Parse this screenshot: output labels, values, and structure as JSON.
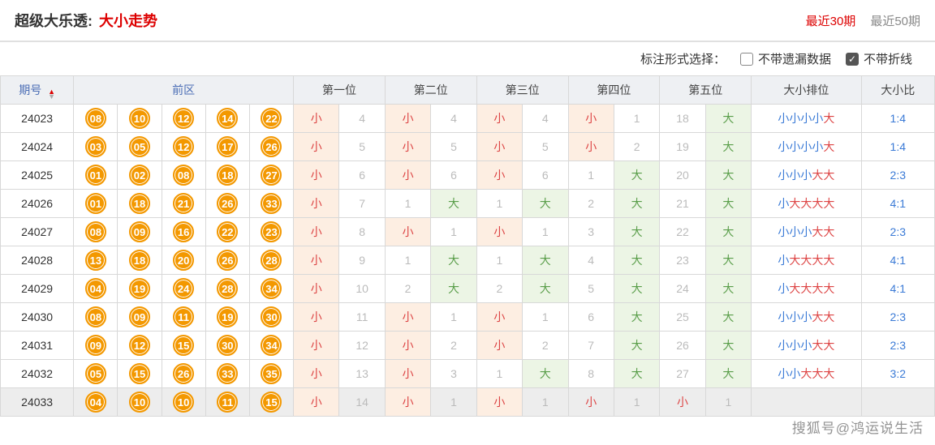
{
  "header": {
    "lottery_name": "超级大乐透:",
    "trend_name": "大小走势",
    "period_30": "最近30期",
    "period_50": "最近50期"
  },
  "options": {
    "label": "标注形式选择：",
    "opt1": "不带遗漏数据",
    "opt2": "不带折线"
  },
  "columns": {
    "qihao": "期号",
    "qianqu": "前区",
    "pos1": "第一位",
    "pos2": "第二位",
    "pos3": "第三位",
    "pos4": "第四位",
    "pos5": "第五位",
    "paiwei": "大小排位",
    "bi": "大小比"
  },
  "rows": [
    {
      "id": "24023",
      "balls": [
        "08",
        "10",
        "12",
        "14",
        "22"
      ],
      "c": [
        [
          "小",
          "h"
        ],
        [
          "4",
          "m"
        ],
        [
          "小",
          "h"
        ],
        [
          "4",
          "m"
        ],
        [
          "小",
          "h"
        ],
        [
          "4",
          "m"
        ],
        [
          "小",
          "h"
        ],
        [
          "1",
          "m"
        ],
        [
          "18",
          "m"
        ],
        [
          "大",
          "d"
        ]
      ],
      "pattern": [
        "x",
        "x",
        "x",
        "x",
        "d"
      ],
      "ratio": "1:4"
    },
    {
      "id": "24024",
      "balls": [
        "03",
        "05",
        "12",
        "17",
        "26"
      ],
      "c": [
        [
          "小",
          "h"
        ],
        [
          "5",
          "m"
        ],
        [
          "小",
          "h"
        ],
        [
          "5",
          "m"
        ],
        [
          "小",
          "h"
        ],
        [
          "5",
          "m"
        ],
        [
          "小",
          "h"
        ],
        [
          "2",
          "m"
        ],
        [
          "19",
          "m"
        ],
        [
          "大",
          "d"
        ]
      ],
      "pattern": [
        "x",
        "x",
        "x",
        "x",
        "d"
      ],
      "ratio": "1:4"
    },
    {
      "id": "24025",
      "balls": [
        "01",
        "02",
        "08",
        "18",
        "27"
      ],
      "c": [
        [
          "小",
          "h"
        ],
        [
          "6",
          "m"
        ],
        [
          "小",
          "h"
        ],
        [
          "6",
          "m"
        ],
        [
          "小",
          "h"
        ],
        [
          "6",
          "m"
        ],
        [
          "1",
          "m"
        ],
        [
          "大",
          "d"
        ],
        [
          "20",
          "m"
        ],
        [
          "大",
          "d"
        ]
      ],
      "pattern": [
        "x",
        "x",
        "x",
        "d",
        "d"
      ],
      "ratio": "2:3"
    },
    {
      "id": "24026",
      "balls": [
        "01",
        "18",
        "21",
        "26",
        "33"
      ],
      "c": [
        [
          "小",
          "h"
        ],
        [
          "7",
          "m"
        ],
        [
          "1",
          "m"
        ],
        [
          "大",
          "d"
        ],
        [
          "1",
          "m"
        ],
        [
          "大",
          "d"
        ],
        [
          "2",
          "m"
        ],
        [
          "大",
          "d"
        ],
        [
          "21",
          "m"
        ],
        [
          "大",
          "d"
        ]
      ],
      "pattern": [
        "x",
        "d",
        "d",
        "d",
        "d"
      ],
      "ratio": "4:1"
    },
    {
      "id": "24027",
      "balls": [
        "08",
        "09",
        "16",
        "22",
        "23"
      ],
      "c": [
        [
          "小",
          "h"
        ],
        [
          "8",
          "m"
        ],
        [
          "小",
          "h"
        ],
        [
          "1",
          "m"
        ],
        [
          "小",
          "h"
        ],
        [
          "1",
          "m"
        ],
        [
          "3",
          "m"
        ],
        [
          "大",
          "d"
        ],
        [
          "22",
          "m"
        ],
        [
          "大",
          "d"
        ]
      ],
      "pattern": [
        "x",
        "x",
        "x",
        "d",
        "d"
      ],
      "ratio": "2:3"
    },
    {
      "id": "24028",
      "balls": [
        "13",
        "18",
        "20",
        "26",
        "28"
      ],
      "c": [
        [
          "小",
          "h"
        ],
        [
          "9",
          "m"
        ],
        [
          "1",
          "m"
        ],
        [
          "大",
          "d"
        ],
        [
          "1",
          "m"
        ],
        [
          "大",
          "d"
        ],
        [
          "4",
          "m"
        ],
        [
          "大",
          "d"
        ],
        [
          "23",
          "m"
        ],
        [
          "大",
          "d"
        ]
      ],
      "pattern": [
        "x",
        "d",
        "d",
        "d",
        "d"
      ],
      "ratio": "4:1"
    },
    {
      "id": "24029",
      "balls": [
        "04",
        "19",
        "24",
        "28",
        "34"
      ],
      "c": [
        [
          "小",
          "h"
        ],
        [
          "10",
          "m"
        ],
        [
          "2",
          "m"
        ],
        [
          "大",
          "d"
        ],
        [
          "2",
          "m"
        ],
        [
          "大",
          "d"
        ],
        [
          "5",
          "m"
        ],
        [
          "大",
          "d"
        ],
        [
          "24",
          "m"
        ],
        [
          "大",
          "d"
        ]
      ],
      "pattern": [
        "x",
        "d",
        "d",
        "d",
        "d"
      ],
      "ratio": "4:1"
    },
    {
      "id": "24030",
      "balls": [
        "08",
        "09",
        "11",
        "19",
        "30"
      ],
      "c": [
        [
          "小",
          "h"
        ],
        [
          "11",
          "m"
        ],
        [
          "小",
          "h"
        ],
        [
          "1",
          "m"
        ],
        [
          "小",
          "h"
        ],
        [
          "1",
          "m"
        ],
        [
          "6",
          "m"
        ],
        [
          "大",
          "d"
        ],
        [
          "25",
          "m"
        ],
        [
          "大",
          "d"
        ]
      ],
      "pattern": [
        "x",
        "x",
        "x",
        "d",
        "d"
      ],
      "ratio": "2:3"
    },
    {
      "id": "24031",
      "balls": [
        "09",
        "12",
        "15",
        "30",
        "34"
      ],
      "c": [
        [
          "小",
          "h"
        ],
        [
          "12",
          "m"
        ],
        [
          "小",
          "h"
        ],
        [
          "2",
          "m"
        ],
        [
          "小",
          "h"
        ],
        [
          "2",
          "m"
        ],
        [
          "7",
          "m"
        ],
        [
          "大",
          "d"
        ],
        [
          "26",
          "m"
        ],
        [
          "大",
          "d"
        ]
      ],
      "pattern": [
        "x",
        "x",
        "x",
        "d",
        "d"
      ],
      "ratio": "2:3"
    },
    {
      "id": "24032",
      "balls": [
        "05",
        "15",
        "26",
        "33",
        "35"
      ],
      "c": [
        [
          "小",
          "h"
        ],
        [
          "13",
          "m"
        ],
        [
          "小",
          "h"
        ],
        [
          "3",
          "m"
        ],
        [
          "1",
          "m"
        ],
        [
          "大",
          "d"
        ],
        [
          "8",
          "m"
        ],
        [
          "大",
          "d"
        ],
        [
          "27",
          "m"
        ],
        [
          "大",
          "d"
        ]
      ],
      "pattern": [
        "x",
        "x",
        "d",
        "d",
        "d"
      ],
      "ratio": "3:2"
    },
    {
      "id": "24033",
      "balls": [
        "04",
        "10",
        "10",
        "11",
        "15"
      ],
      "c": [
        [
          "小",
          "h"
        ],
        [
          "14",
          "m"
        ],
        [
          "小",
          "h"
        ],
        [
          "1",
          "m"
        ],
        [
          "小",
          "h"
        ],
        [
          "1",
          "m"
        ],
        [
          "小",
          "r"
        ],
        [
          "1",
          "m"
        ],
        [
          "小",
          "r"
        ],
        [
          "1",
          "m"
        ]
      ],
      "pattern": [],
      "ratio": ""
    }
  ],
  "chart_data": {
    "type": "table",
    "title": "超级大乐透 大小走势",
    "columns": [
      "期号",
      "前区1",
      "前区2",
      "前区3",
      "前区4",
      "前区5",
      "第一位-小",
      "第一位-遗漏",
      "第二位-小",
      "第二位-遗漏",
      "第三位-小",
      "第三位-遗漏",
      "第四位-小/大",
      "第四位-遗漏",
      "第五位-小/大",
      "第五位-遗漏",
      "大小排位",
      "大小比"
    ],
    "data": [
      [
        "24023",
        8,
        10,
        12,
        14,
        22,
        "小",
        4,
        "小",
        4,
        "小",
        4,
        "小",
        1,
        18,
        "大",
        "小小小小大",
        "1:4"
      ],
      [
        "24024",
        3,
        5,
        12,
        17,
        26,
        "小",
        5,
        "小",
        5,
        "小",
        5,
        "小",
        2,
        19,
        "大",
        "小小小小大",
        "1:4"
      ],
      [
        "24025",
        1,
        2,
        8,
        18,
        27,
        "小",
        6,
        "小",
        6,
        "小",
        6,
        1,
        "大",
        20,
        "大",
        "小小小大大",
        "2:3"
      ],
      [
        "24026",
        1,
        18,
        21,
        26,
        33,
        "小",
        7,
        1,
        "大",
        1,
        "大",
        2,
        "大",
        21,
        "大",
        "小大大大大",
        "4:1"
      ],
      [
        "24027",
        8,
        9,
        16,
        22,
        23,
        "小",
        8,
        "小",
        1,
        "小",
        1,
        3,
        "大",
        22,
        "大",
        "小小小大大",
        "2:3"
      ],
      [
        "24028",
        13,
        18,
        20,
        26,
        28,
        "小",
        9,
        1,
        "大",
        1,
        "大",
        4,
        "大",
        23,
        "大",
        "小大大大大",
        "4:1"
      ],
      [
        "24029",
        4,
        19,
        24,
        28,
        34,
        "小",
        10,
        2,
        "大",
        2,
        "大",
        5,
        "大",
        24,
        "大",
        "小大大大大",
        "4:1"
      ],
      [
        "24030",
        8,
        9,
        11,
        19,
        30,
        "小",
        11,
        "小",
        1,
        "小",
        1,
        6,
        "大",
        25,
        "大",
        "小小小大大",
        "2:3"
      ],
      [
        "24031",
        9,
        12,
        15,
        30,
        34,
        "小",
        12,
        "小",
        2,
        "小",
        2,
        7,
        "大",
        26,
        "大",
        "小小小大大",
        "2:3"
      ],
      [
        "24032",
        5,
        15,
        26,
        33,
        35,
        "小",
        13,
        "小",
        3,
        1,
        "大",
        8,
        "大",
        27,
        "大",
        "小小大大大",
        "3:2"
      ],
      [
        "24033",
        4,
        10,
        10,
        11,
        15,
        "小",
        14,
        "小",
        1,
        "小",
        1,
        "小",
        1,
        "小",
        1,
        "",
        ""
      ]
    ]
  },
  "watermark": "搜狐号@鸿运说生活"
}
